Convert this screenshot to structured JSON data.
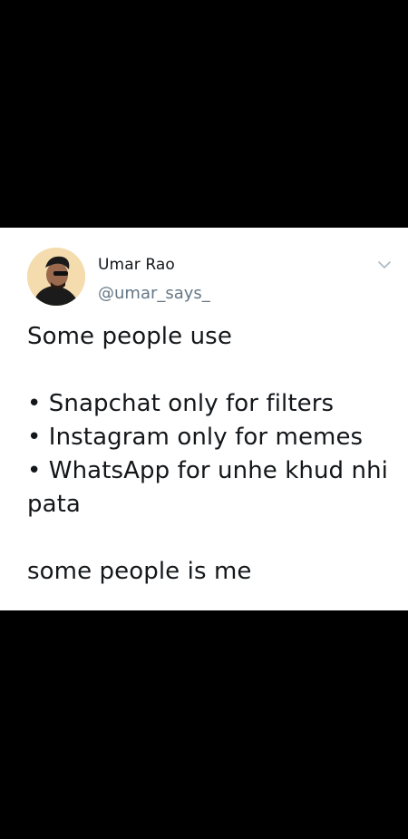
{
  "tweet": {
    "author": {
      "display_name": "Umar Rao",
      "handle": "@umar_says_"
    },
    "menu_icon": "chevron-down-icon",
    "body": {
      "intro": "Some people use",
      "bullets": [
        "• Snapchat only for filters",
        "• Instagram only for memes",
        "• WhatsApp for unhe khud nhi"
      ],
      "bullet_continuation": "pata",
      "closing": "some people is me"
    }
  },
  "colors": {
    "background": "#000000",
    "card": "#ffffff",
    "text": "#14171a",
    "secondary": "#657786"
  }
}
